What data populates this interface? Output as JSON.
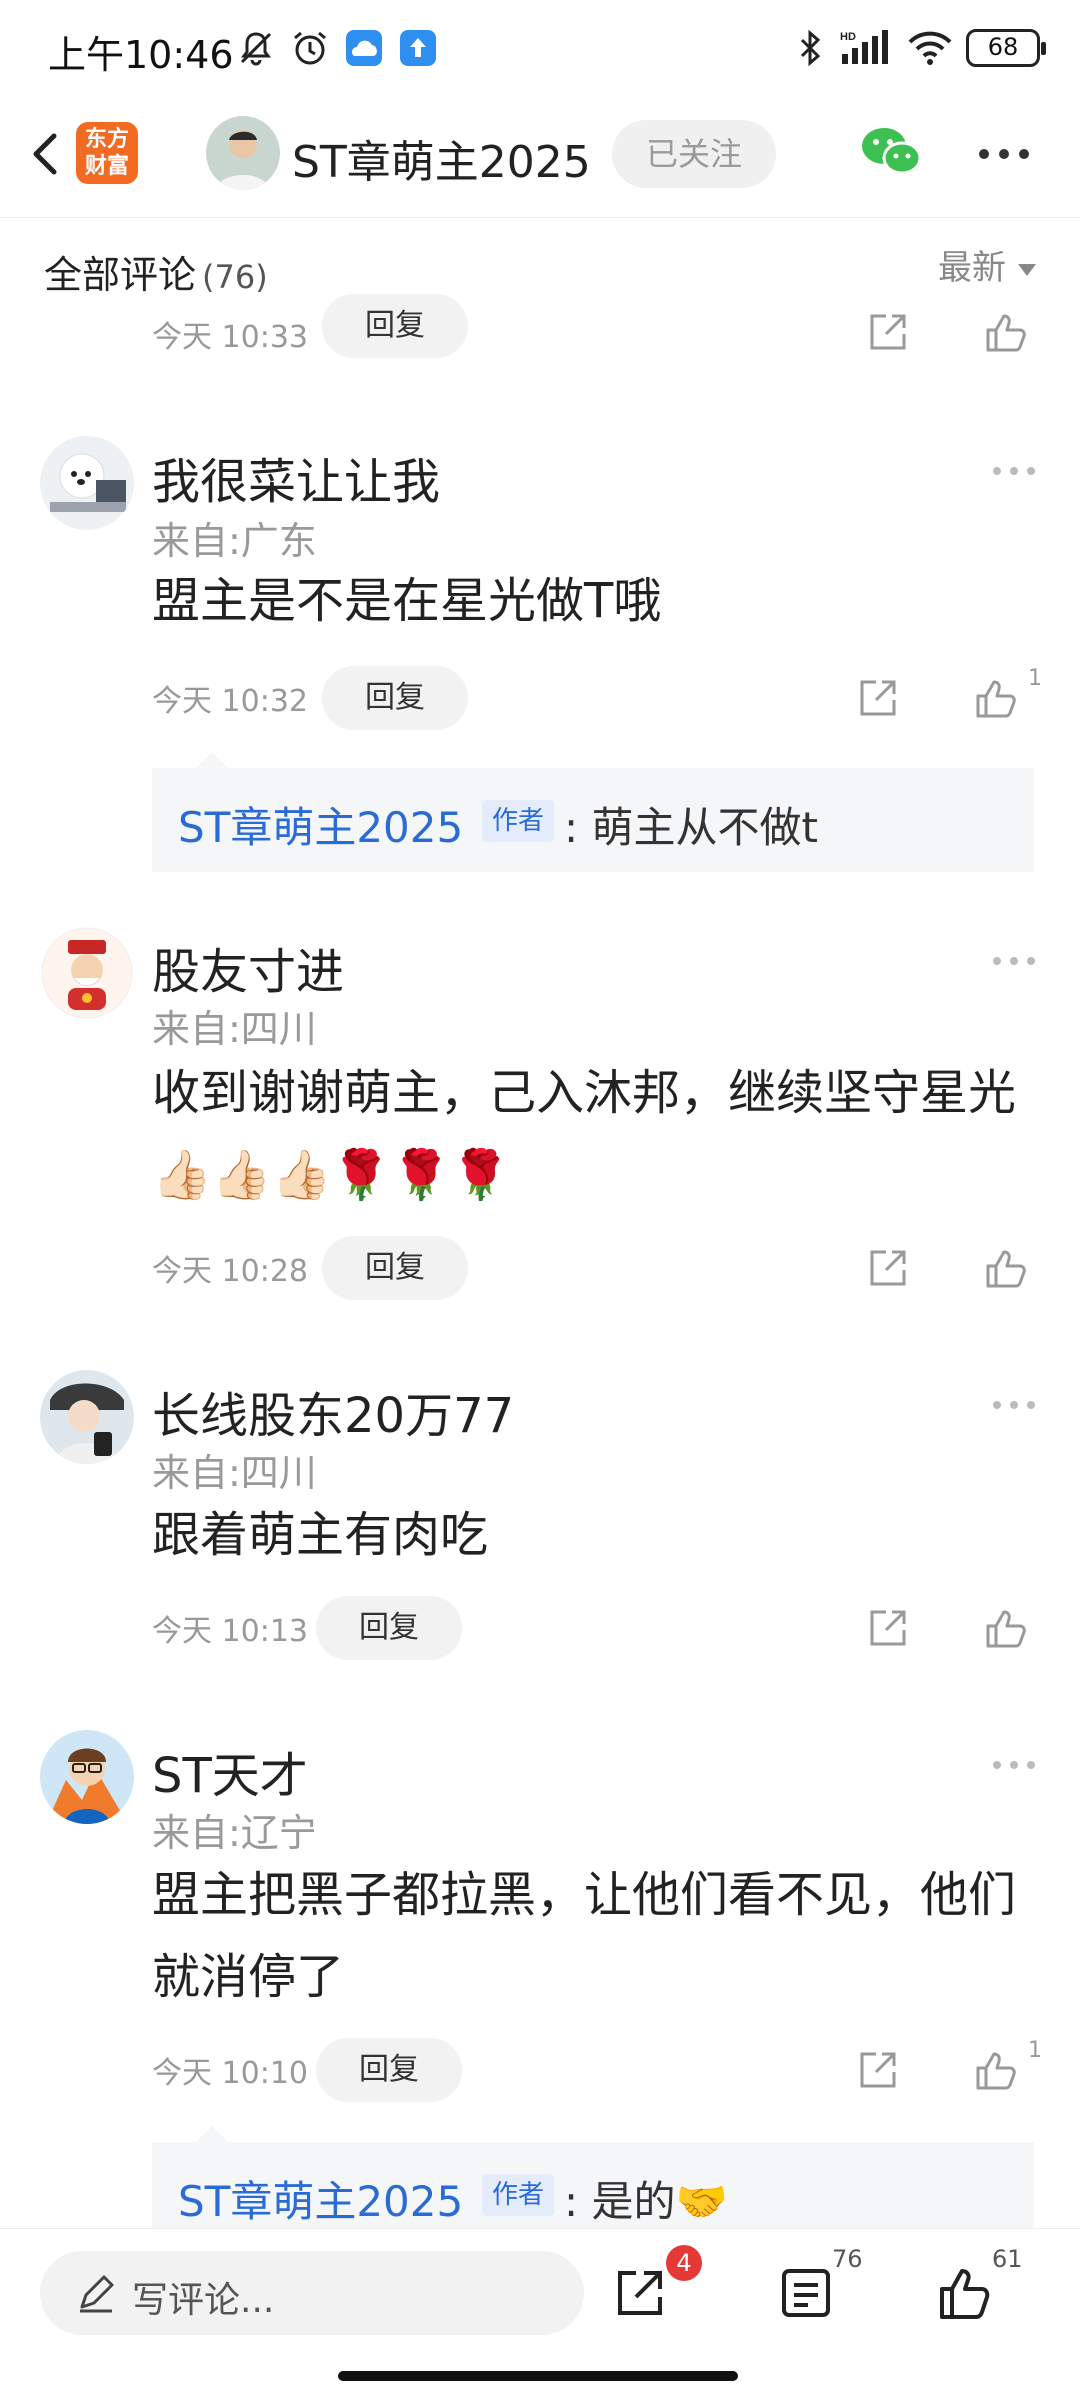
{
  "status_bar": {
    "time": "上午10:46",
    "battery": "68",
    "icons": [
      "mute-bell-icon",
      "alarm-icon",
      "weather-app-icon",
      "upload-app-icon",
      "bluetooth-icon",
      "hd-signal-icon",
      "wifi-icon",
      "battery-icon"
    ]
  },
  "header": {
    "logo_text_line1": "东方",
    "logo_text_line2": "财富",
    "title": "ST章萌主2025",
    "follow_label": "已关注",
    "icons": [
      "back-icon",
      "wechat-icon",
      "more-icon"
    ]
  },
  "comments_section": {
    "title": "全部评论",
    "count": "(76)",
    "sort_label": "最新"
  },
  "partial_item": {
    "time": "今天 10:33",
    "reply_label": "回复"
  },
  "comments": [
    {
      "name": "我很菜让让我",
      "location": "来自:广东",
      "text": "盟主是不是在星光做T哦",
      "time": "今天 10:32",
      "reply_label": "回复",
      "likes": "1",
      "reply": {
        "author": "ST章萌主2025",
        "tag": "作者",
        "text": ": 萌主从不做t"
      }
    },
    {
      "name": "股友寸进",
      "location": "来自:四川",
      "text": "收到谢谢萌主，己入沐邦，继续坚守星光👍🏻👍🏻👍🏻🌹🌹🌹",
      "time": "今天 10:28",
      "reply_label": "回复",
      "likes": ""
    },
    {
      "name": "长线股东20万77",
      "location": "来自:四川",
      "text": "跟着萌主有肉吃",
      "time": "今天 10:13",
      "reply_label": "回复",
      "likes": ""
    },
    {
      "name": "ST天才",
      "location": "来自:辽宁",
      "text": "盟主把黑子都拉黑，让他们看不见，他们就消停了",
      "time": "今天 10:10",
      "reply_label": "回复",
      "likes": "1",
      "reply": {
        "author": "ST章萌主2025",
        "tag": "作者",
        "text": ": 是的🤝"
      }
    }
  ],
  "bottom_bar": {
    "placeholder": "写评论...",
    "share_badge": "4",
    "comment_count": "76",
    "like_count": "61"
  },
  "colors": {
    "accent_blue": "#2a6bd6",
    "brand_orange": "#f36a22",
    "badge_red": "#e53935",
    "wechat_green": "#3cc051"
  }
}
